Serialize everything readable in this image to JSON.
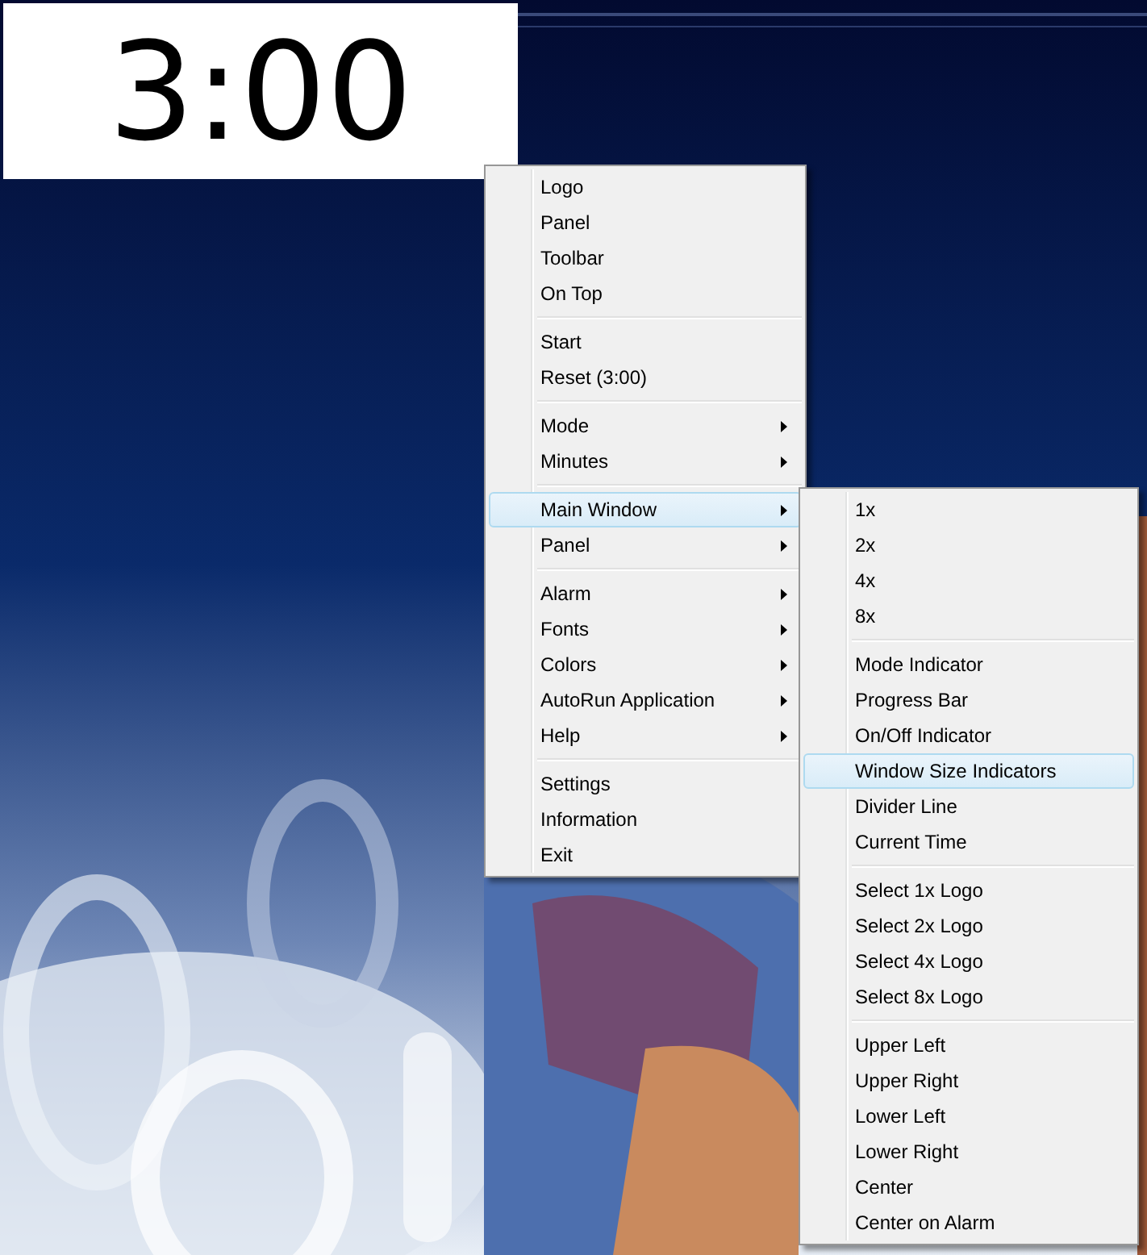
{
  "timer_display": {
    "text": "3:00"
  },
  "context_menu": {
    "groups": [
      [
        {
          "label": "Logo",
          "submenu": false,
          "selected": false
        },
        {
          "label": "Panel",
          "submenu": false,
          "selected": false
        },
        {
          "label": "Toolbar",
          "submenu": false,
          "selected": false
        },
        {
          "label": "On Top",
          "submenu": false,
          "selected": false
        }
      ],
      [
        {
          "label": "Start",
          "submenu": false,
          "selected": false
        },
        {
          "label": "Reset (3:00)",
          "submenu": false,
          "selected": false
        }
      ],
      [
        {
          "label": "Mode",
          "submenu": true,
          "selected": false
        },
        {
          "label": "Minutes",
          "submenu": true,
          "selected": false
        }
      ],
      [
        {
          "label": "Main Window",
          "submenu": true,
          "selected": true
        },
        {
          "label": "Panel",
          "submenu": true,
          "selected": false
        }
      ],
      [
        {
          "label": "Alarm",
          "submenu": true,
          "selected": false
        },
        {
          "label": "Fonts",
          "submenu": true,
          "selected": false
        },
        {
          "label": "Colors",
          "submenu": true,
          "selected": false
        },
        {
          "label": "AutoRun Application",
          "submenu": true,
          "selected": false
        },
        {
          "label": "Help",
          "submenu": true,
          "selected": false
        }
      ],
      [
        {
          "label": "Settings",
          "submenu": false,
          "selected": false
        },
        {
          "label": "Information",
          "submenu": false,
          "selected": false
        },
        {
          "label": "Exit",
          "submenu": false,
          "selected": false
        }
      ]
    ]
  },
  "submenu": {
    "groups": [
      [
        {
          "label": "1x",
          "submenu": false,
          "selected": false
        },
        {
          "label": "2x",
          "submenu": false,
          "selected": false
        },
        {
          "label": "4x",
          "submenu": false,
          "selected": false
        },
        {
          "label": "8x",
          "submenu": false,
          "selected": false
        }
      ],
      [
        {
          "label": "Mode Indicator",
          "submenu": false,
          "selected": false
        },
        {
          "label": "Progress Bar",
          "submenu": false,
          "selected": false
        },
        {
          "label": "On/Off Indicator",
          "submenu": false,
          "selected": false
        },
        {
          "label": "Window Size Indicators",
          "submenu": false,
          "selected": true
        },
        {
          "label": "Divider Line",
          "submenu": false,
          "selected": false
        },
        {
          "label": "Current Time",
          "submenu": false,
          "selected": false
        }
      ],
      [
        {
          "label": "Select 1x Logo",
          "submenu": false,
          "selected": false
        },
        {
          "label": "Select 2x Logo",
          "submenu": false,
          "selected": false
        },
        {
          "label": "Select 4x Logo",
          "submenu": false,
          "selected": false
        },
        {
          "label": "Select 8x Logo",
          "submenu": false,
          "selected": false
        }
      ],
      [
        {
          "label": "Upper Left",
          "submenu": false,
          "selected": false
        },
        {
          "label": "Upper Right",
          "submenu": false,
          "selected": false
        },
        {
          "label": "Lower Left",
          "submenu": false,
          "selected": false
        },
        {
          "label": "Lower Right",
          "submenu": false,
          "selected": false
        },
        {
          "label": "Center",
          "submenu": false,
          "selected": false
        },
        {
          "label": "Center on Alarm",
          "submenu": false,
          "selected": false
        }
      ]
    ]
  }
}
